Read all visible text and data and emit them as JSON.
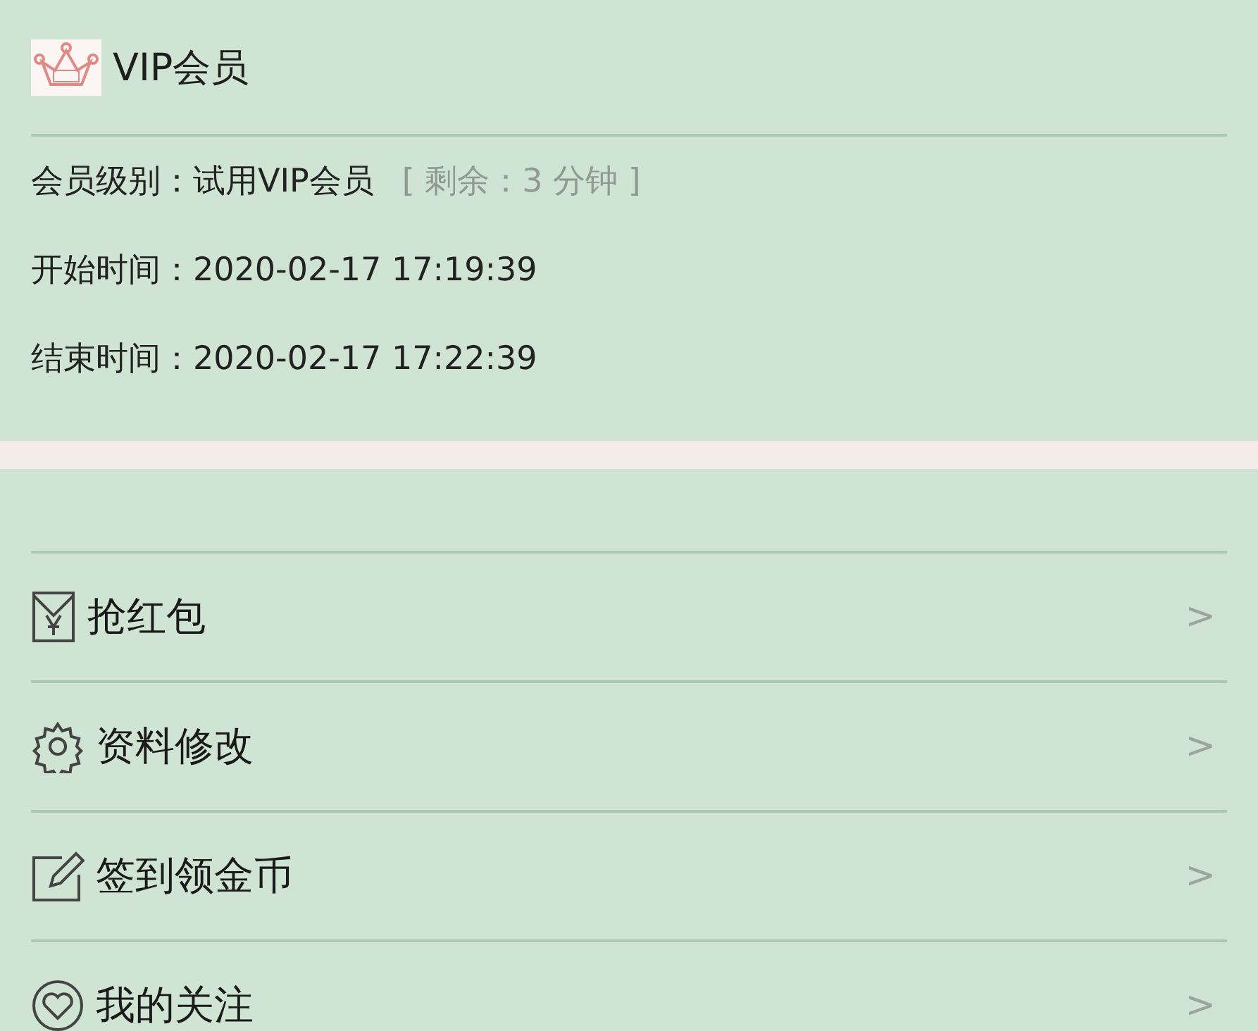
{
  "vip": {
    "title": "VIP会员",
    "lines": [
      {
        "label": "会员级别：",
        "value": "试用VIP会员",
        "note": "[ 剩余：3 分钟 ]"
      },
      {
        "label": "开始时间：",
        "value": "2020-02-17 17:19:39"
      },
      {
        "label": "结束时间：",
        "value": "2020-02-17 17:22:39"
      }
    ]
  },
  "menu": [
    {
      "kind": "envelope",
      "label": "抢红包",
      "arrow": ">"
    },
    {
      "kind": "gear",
      "label": "资料修改",
      "arrow": ">"
    },
    {
      "kind": "edit",
      "label": "签到领金币",
      "arrow": ">"
    },
    {
      "kind": "heart",
      "label": "我的关注",
      "arrow": ">"
    }
  ]
}
